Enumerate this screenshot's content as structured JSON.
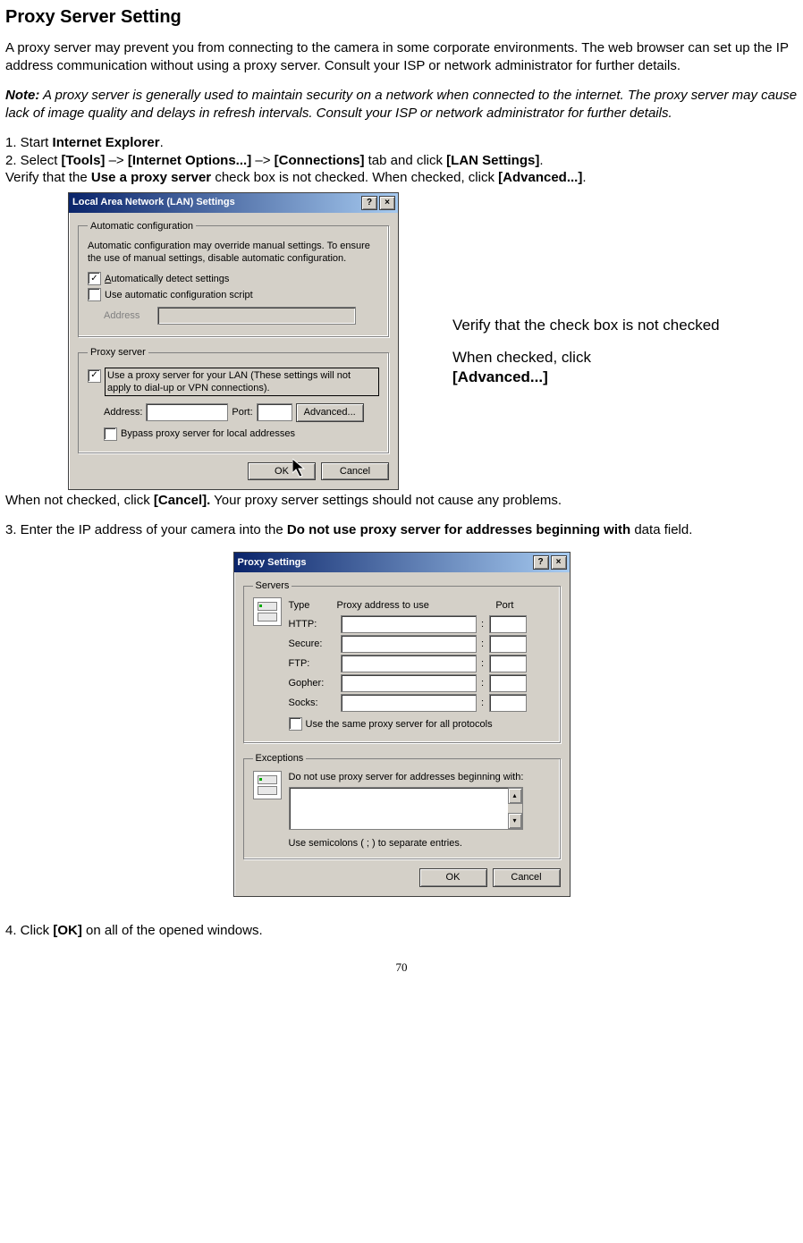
{
  "title": "Proxy Server Setting",
  "intro": "A proxy server may prevent you from connecting to the camera in some corporate environments. The web browser can set up the IP address communication without using a proxy server. Consult your ISP or network administrator for further details.",
  "note_label": "Note:",
  "note_body": " A proxy server is generally used to maintain security on a network when connected to the internet. The proxy server may cause lack of image quality and delays in refresh intervals. Consult your ISP or network administrator for further details.",
  "step1_a": "1. Start ",
  "step1_b": "Internet Explorer",
  "step1_c": ".",
  "step2_a": "2. Select ",
  "step2_b": "[Tools]",
  "step2_c": " –> ",
  "step2_d": "[Internet Options...]",
  "step2_e": " –> ",
  "step2_f": "[Connections]",
  "step2_g": " tab and click ",
  "step2_h": "[LAN Settings]",
  "step2_i": ".",
  "verify_a": "Verify that the ",
  "verify_b": "Use a proxy server",
  "verify_c": " check box is not checked. When checked, click ",
  "verify_d": "[Advanced...]",
  "verify_e": ".",
  "annot1": "Verify that the check box is not checked",
  "annot2_a": "When checked, click ",
  "annot2_b": "[Advanced...]",
  "after1_a": "When not checked, click ",
  "after1_b": "[Cancel].",
  "after1_c": " Your proxy server settings should not cause any problems.",
  "step3_a": "3. Enter the IP address of your camera into the ",
  "step3_b": "Do not use proxy server for addresses beginning with",
  "step3_c": " data field.",
  "step4_a": "4. Click ",
  "step4_b": "[OK]",
  "step4_c": " on all of the opened windows.",
  "page": "70",
  "lan": {
    "title": "Local Area Network (LAN) Settings",
    "grp_auto": "Automatic configuration",
    "auto_hint": "Automatic configuration may override manual settings.  To ensure the use of manual settings, disable automatic configuration.",
    "auto_detect": "Automatically detect settings",
    "auto_script": "Use automatic configuration script",
    "addr": "Address",
    "grp_proxy": "Proxy server",
    "proxy_use": "Use a proxy server for your LAN (These settings will not apply to dial-up or VPN connections).",
    "addr2": "Address:",
    "port": "Port:",
    "advanced": "Advanced...",
    "bypass": "Bypass proxy server for local addresses",
    "ok": "OK",
    "cancel": "Cancel"
  },
  "ps": {
    "title": "Proxy Settings",
    "grp_srv": "Servers",
    "type": "Type",
    "proxy_addr": "Proxy address to use",
    "port": "Port",
    "http": "HTTP:",
    "secure": "Secure:",
    "ftp": "FTP:",
    "gopher": "Gopher:",
    "socks": "Socks:",
    "same": "Use the same proxy server for all protocols",
    "grp_exc": "Exceptions",
    "exc_lbl": "Do not use proxy server for addresses beginning with:",
    "exc_hint": "Use semicolons ( ; ) to separate entries.",
    "ok": "OK",
    "cancel": "Cancel"
  }
}
